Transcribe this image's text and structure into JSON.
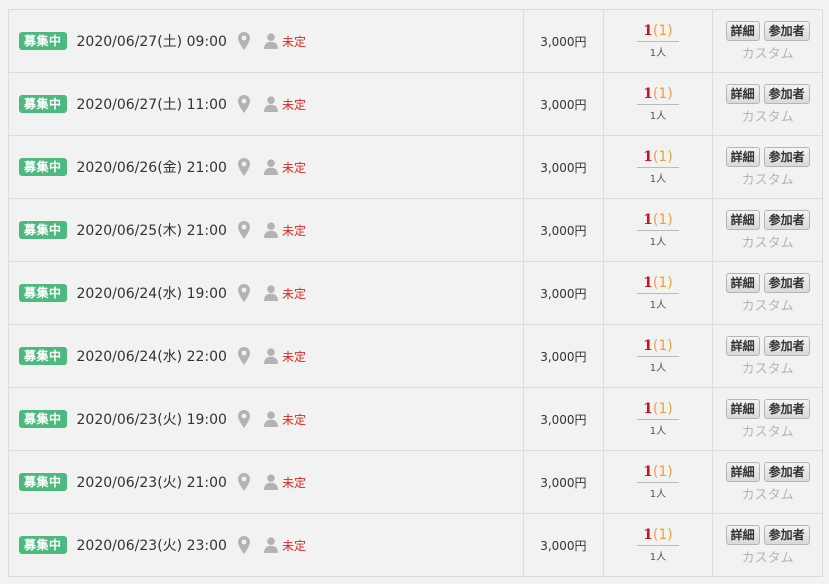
{
  "rows": [
    {
      "status": "募集中",
      "datetime": "2020/06/27(土) 09:00",
      "venue": "未定",
      "price": "3,000円",
      "count_number": "1",
      "count_paren": "(1)",
      "capacity": "1人",
      "detail_label": "詳細",
      "participants_label": "参加者",
      "custom_label": "カスタム"
    },
    {
      "status": "募集中",
      "datetime": "2020/06/27(土) 11:00",
      "venue": "未定",
      "price": "3,000円",
      "count_number": "1",
      "count_paren": "(1)",
      "capacity": "1人",
      "detail_label": "詳細",
      "participants_label": "参加者",
      "custom_label": "カスタム"
    },
    {
      "status": "募集中",
      "datetime": "2020/06/26(金) 21:00",
      "venue": "未定",
      "price": "3,000円",
      "count_number": "1",
      "count_paren": "(1)",
      "capacity": "1人",
      "detail_label": "詳細",
      "participants_label": "参加者",
      "custom_label": "カスタム"
    },
    {
      "status": "募集中",
      "datetime": "2020/06/25(木) 21:00",
      "venue": "未定",
      "price": "3,000円",
      "count_number": "1",
      "count_paren": "(1)",
      "capacity": "1人",
      "detail_label": "詳細",
      "participants_label": "参加者",
      "custom_label": "カスタム"
    },
    {
      "status": "募集中",
      "datetime": "2020/06/24(水) 19:00",
      "venue": "未定",
      "price": "3,000円",
      "count_number": "1",
      "count_paren": "(1)",
      "capacity": "1人",
      "detail_label": "詳細",
      "participants_label": "参加者",
      "custom_label": "カスタム"
    },
    {
      "status": "募集中",
      "datetime": "2020/06/24(水) 22:00",
      "venue": "未定",
      "price": "3,000円",
      "count_number": "1",
      "count_paren": "(1)",
      "capacity": "1人",
      "detail_label": "詳細",
      "participants_label": "参加者",
      "custom_label": "カスタム"
    },
    {
      "status": "募集中",
      "datetime": "2020/06/23(火) 19:00",
      "venue": "未定",
      "price": "3,000円",
      "count_number": "1",
      "count_paren": "(1)",
      "capacity": "1人",
      "detail_label": "詳細",
      "participants_label": "参加者",
      "custom_label": "カスタム"
    },
    {
      "status": "募集中",
      "datetime": "2020/06/23(火) 21:00",
      "venue": "未定",
      "price": "3,000円",
      "count_number": "1",
      "count_paren": "(1)",
      "capacity": "1人",
      "detail_label": "詳細",
      "participants_label": "参加者",
      "custom_label": "カスタム"
    },
    {
      "status": "募集中",
      "datetime": "2020/06/23(火) 23:00",
      "venue": "未定",
      "price": "3,000円",
      "count_number": "1",
      "count_paren": "(1)",
      "capacity": "1人",
      "detail_label": "詳細",
      "participants_label": "参加者",
      "custom_label": "カスタム"
    }
  ],
  "colors": {
    "status_badge": "#4cb97f",
    "venue_text": "#e0261c",
    "count_number": "#c8102e",
    "count_paren": "#e8a33d",
    "custom_text": "#b5b5b5"
  },
  "icons": {
    "location": "map-pin-icon",
    "organizer": "person-icon"
  }
}
